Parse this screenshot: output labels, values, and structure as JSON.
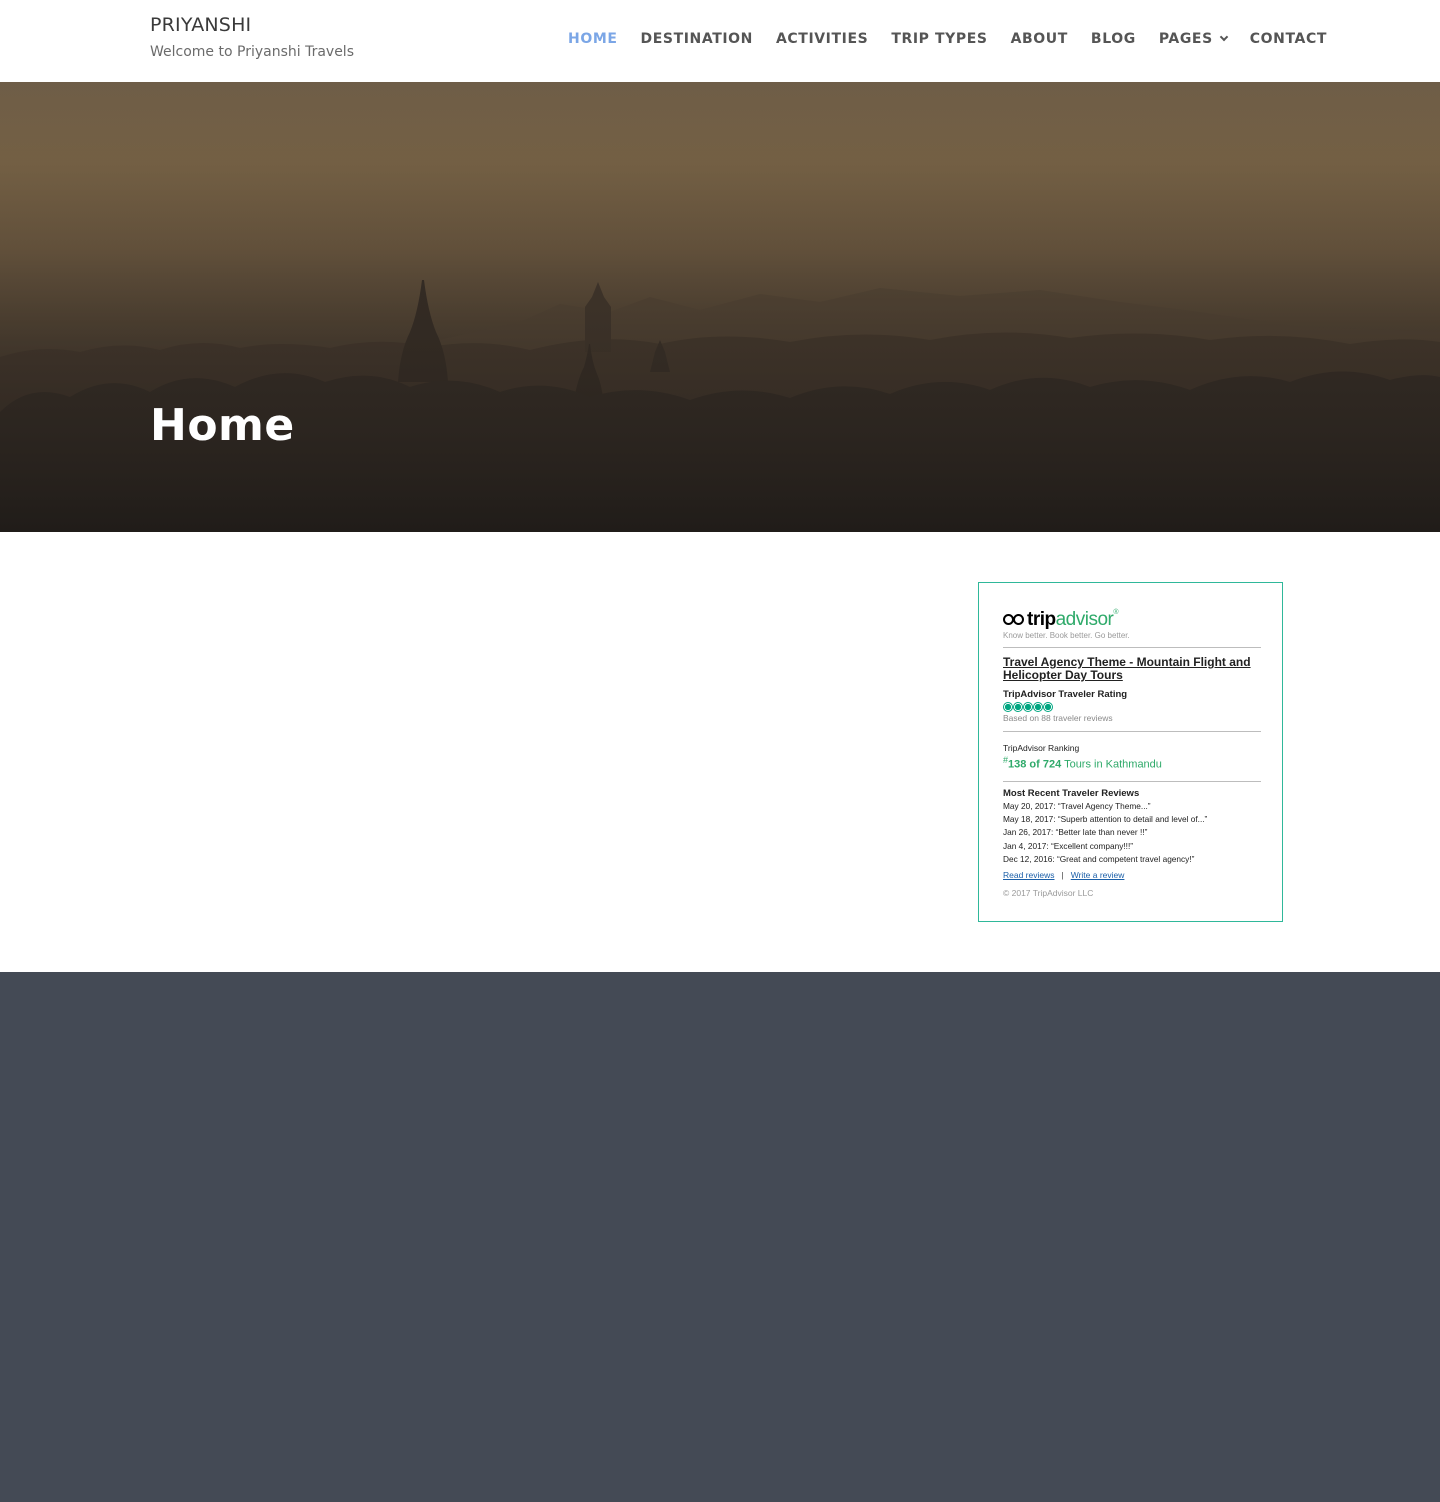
{
  "site": {
    "title": "PRIYANSHI",
    "tagline": "Welcome to Priyanshi Travels"
  },
  "nav": {
    "items": [
      {
        "label": "HOME",
        "active": true
      },
      {
        "label": "DESTINATION"
      },
      {
        "label": "ACTIVITIES"
      },
      {
        "label": "TRIP TYPES"
      },
      {
        "label": "ABOUT"
      },
      {
        "label": "BLOG"
      },
      {
        "label": "PAGES",
        "has_dropdown": true,
        "icon": "chevron-down-icon"
      },
      {
        "label": "CONTACT"
      }
    ]
  },
  "hero": {
    "title": "Home"
  },
  "widget": {
    "logo_trip": "trip",
    "logo_advisor": "advisor",
    "logo_mark": "®",
    "tagline": "Know better. Book better. Go better.",
    "listing_title": "Travel Agency Theme - Mountain Flight and Helicopter Day Tours",
    "rating_label": "TripAdvisor Traveler Rating",
    "rating_bubbles": 5,
    "based_on": "Based on 88 traveler reviews",
    "ranking_label": "TripAdvisor Ranking",
    "ranking_hash": "#",
    "ranking_value": "138 of 724",
    "ranking_suffix": " Tours in Kathmandu",
    "reviews_title": "Most Recent Traveler Reviews",
    "reviews": [
      "May 20, 2017: “Travel Agency Theme...”",
      "May 18, 2017: “Superb attention to detail and level of...”",
      "Jan 26, 2017: “Better late than never !!”",
      "Jan 4, 2017: “Excellent company!!!”",
      "Dec 12, 2016: “Great and competent travel agency!”"
    ],
    "read_reviews": "Read reviews",
    "separator": "|",
    "write_review": "Write a review",
    "copyright": "© 2017 TripAdvisor LLC"
  },
  "colors": {
    "nav_active": "#7ba6e6",
    "widget_border": "#2fb89a",
    "tripadvisor_green": "#2faa6a",
    "footer_bg": "#444a55"
  }
}
